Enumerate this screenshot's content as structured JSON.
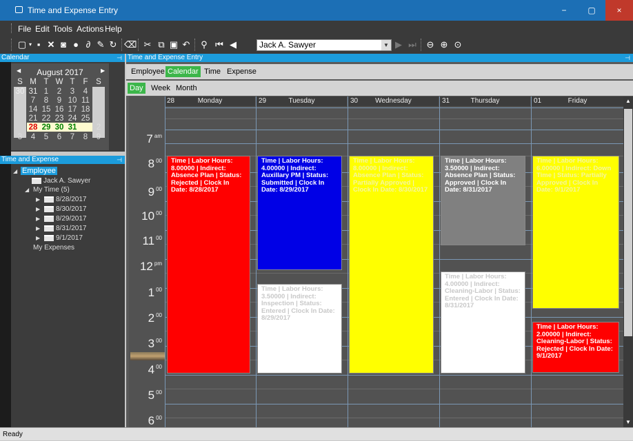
{
  "window": {
    "title": "Time and Expense Entry",
    "controls": [
      "−",
      "▢",
      "×"
    ]
  },
  "menu": [
    "File",
    "Edit",
    "Tools",
    "Actions",
    "Help"
  ],
  "toolbar": {
    "employee_value": "Jack A. Sawyer"
  },
  "calendar_panel": {
    "title": "Calendar",
    "month": "August 2017",
    "weekdays": [
      "S",
      "M",
      "T",
      "W",
      "T",
      "F",
      "S"
    ],
    "weeks": [
      [
        "30",
        "31",
        "1",
        "2",
        "3",
        "4",
        ""
      ],
      [
        "",
        "7",
        "8",
        "9",
        "10",
        "11",
        ""
      ],
      [
        "",
        "14",
        "15",
        "16",
        "17",
        "18",
        ""
      ],
      [
        "",
        "21",
        "22",
        "23",
        "24",
        "25",
        ""
      ],
      [
        "",
        "28",
        "29",
        "30",
        "31",
        "",
        "2"
      ],
      [
        "3",
        "4",
        "5",
        "6",
        "7",
        "8",
        "9"
      ]
    ]
  },
  "tree_panel": {
    "title": "Time and Expense",
    "employee_label": "Employee",
    "employee_name": "Jack A. Sawyer",
    "my_time": "My Time (5)",
    "dates": [
      "8/28/2017",
      "8/30/2017",
      "8/29/2017",
      "8/31/2017",
      "9/1/2017"
    ],
    "my_expenses": "My Expenses"
  },
  "main_panel": {
    "title": "Time and Expense Entry"
  },
  "tabs": [
    "Employee",
    "Calendar",
    "Time",
    "Expense"
  ],
  "active_tab": "Calendar",
  "view_tabs": [
    "Day",
    "Week",
    "Month"
  ],
  "active_view": "Day",
  "days": [
    {
      "num": "28",
      "name": "Monday"
    },
    {
      "num": "29",
      "name": "Tuesday"
    },
    {
      "num": "30",
      "name": "Wednesday"
    },
    {
      "num": "31",
      "name": "Thursday"
    },
    {
      "num": "01",
      "name": "Friday"
    }
  ],
  "hours": [
    {
      "h": "7",
      "m": "am"
    },
    {
      "h": "8",
      "m": "00"
    },
    {
      "h": "9",
      "m": "00"
    },
    {
      "h": "10",
      "m": "00"
    },
    {
      "h": "11",
      "m": "00"
    },
    {
      "h": "12",
      "m": "pm"
    },
    {
      "h": "1",
      "m": "00"
    },
    {
      "h": "2",
      "m": "00"
    },
    {
      "h": "3",
      "m": "00"
    },
    {
      "h": "4",
      "m": "00"
    },
    {
      "h": "5",
      "m": "00"
    },
    {
      "h": "6",
      "m": "00"
    }
  ],
  "events": [
    {
      "text": "Time | Labor Hours: 8.00000 | Indirect: Absence Plan | Status: Rejected | Clock In Date: 8/28/2017",
      "bg": "#ff0000",
      "fg": "#ffffff"
    },
    {
      "text": "Time | Labor Hours: 4.00000 | Indirect: Auxillary PM | Status: Submitted | Clock In Date: 8/29/2017",
      "bg": "#0000e6",
      "fg": "#ffffff"
    },
    {
      "text": "Time | Labor Hours: 3.50000 | Indirect: Inspection | Status: Entered | Clock In Date: 8/29/2017",
      "bg": "#ffffff",
      "fg": "#c8c8c8"
    },
    {
      "text": "Time | Labor Hours: 8.00000 | Indirect: Absence Plan | Status: Partially Approved | Clock In Date: 8/30/2017",
      "bg": "#ffff00",
      "fg": "#f5f5a0"
    },
    {
      "text": "Time | Labor Hours: 3.50000 | Indirect: Absence Plan | Status: Approved | Clock In Date: 8/31/2017",
      "bg": "#808080",
      "fg": "#ffffff"
    },
    {
      "text": "Time | Labor Hours: 4.00000 | Indirect: Cleaning-Labor | Status: Entered | Clock In Date: 8/31/2017",
      "bg": "#ffffff",
      "fg": "#c8c8c8"
    },
    {
      "text": "Time | Labor Hours: 6.00000 | Indirect: Down Time | Status: Partially Approved | Clock In Date: 9/1/2017",
      "bg": "#ffff00",
      "fg": "#f5f5a0"
    },
    {
      "text": "Time | Labor Hours: 2.00000 | Indirect: Cleaning-Labor | Status: Rejected | Clock In Date: 9/1/2017",
      "bg": "#ff0000",
      "fg": "#ffffff"
    }
  ],
  "status": "Ready"
}
